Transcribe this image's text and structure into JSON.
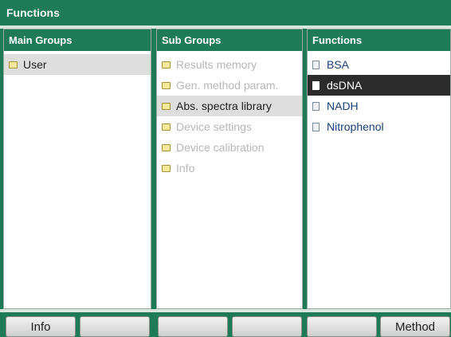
{
  "window": {
    "title": "Functions"
  },
  "main_groups": {
    "header": "Main Groups",
    "items": [
      {
        "label": "User",
        "state": "selected"
      }
    ]
  },
  "sub_groups": {
    "header": "Sub Groups",
    "items": [
      {
        "label": "Results memory",
        "state": "disabled"
      },
      {
        "label": "Gen. method param.",
        "state": "disabled"
      },
      {
        "label": "Abs. spectra library",
        "state": "selected"
      },
      {
        "label": "Device settings",
        "state": "disabled"
      },
      {
        "label": "Device calibration",
        "state": "disabled"
      },
      {
        "label": "Info",
        "state": "disabled"
      }
    ]
  },
  "functions": {
    "header": "Functions",
    "items": [
      {
        "label": "BSA",
        "state": "normal"
      },
      {
        "label": "dsDNA",
        "state": "selected"
      },
      {
        "label": "NADH",
        "state": "normal"
      },
      {
        "label": "Nitrophenol",
        "state": "normal"
      }
    ]
  },
  "softkeys": [
    "Info",
    "",
    "",
    "",
    "",
    "Method"
  ],
  "icons": {
    "group_item": "folder-icon",
    "function_item": "file-icon"
  },
  "colors": {
    "header_bg": "#1f7a57",
    "selected_dark": "#2b2b2b",
    "selected_gray": "#dedede",
    "disabled_text": "#b8b8b8",
    "function_text": "#1a3f7a"
  }
}
